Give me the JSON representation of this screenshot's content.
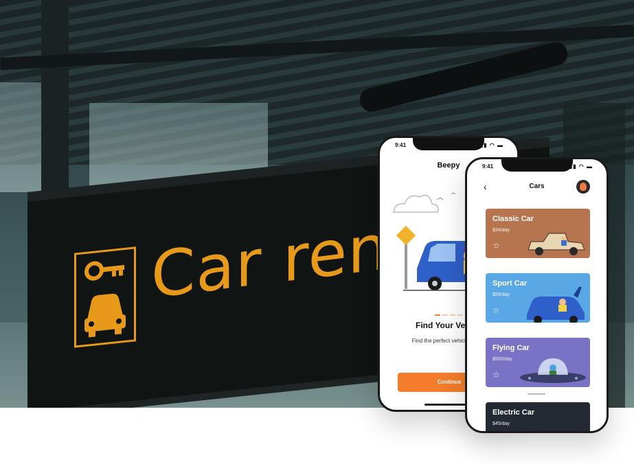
{
  "sign": {
    "text": "Car rent"
  },
  "phone_onboarding": {
    "status_time": "9:41",
    "status_icons": "▮▮ ◠ ▬",
    "app_title": "Beepy",
    "heading": "Find Your Vehi",
    "subtitle": "Find the perfect vehicle occasion!",
    "button_label": "Continue"
  },
  "phone_cars": {
    "status_time": "9:41",
    "status_icons": "▮▮ ◠ ▬",
    "back_icon": "chevron-left-icon",
    "title": "Cars",
    "cards": [
      {
        "name": "Classic Car",
        "price": "$34/day",
        "color": "#b6744f"
      },
      {
        "name": "Sport Car",
        "price": "$55/day",
        "color": "#5aa7e6"
      },
      {
        "name": "Flying Car",
        "price": "$500/day",
        "color": "#7a72c4"
      },
      {
        "name": "Electric Car",
        "price": "$45/day",
        "color": "#232a33"
      }
    ]
  },
  "colors": {
    "accent": "#f57c2a",
    "sign_text": "#e79a1a"
  }
}
